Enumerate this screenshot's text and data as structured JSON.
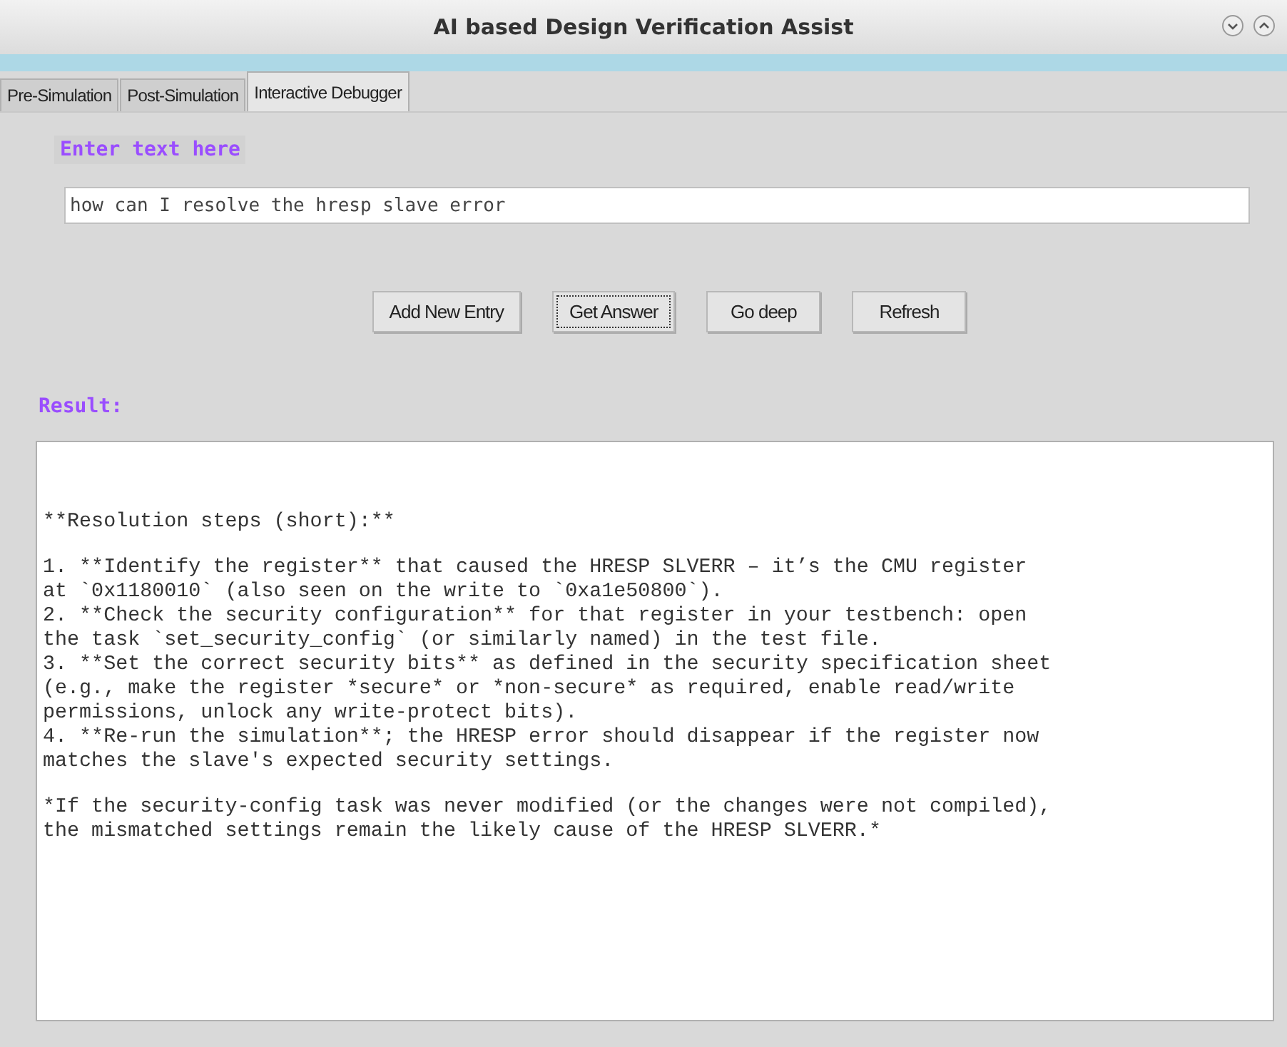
{
  "window": {
    "title": "AI based Design Verification Assist"
  },
  "title_buttons": [
    {
      "kind": "minimize"
    },
    {
      "kind": "maximize"
    }
  ],
  "tabs": [
    {
      "label": "Pre-Simulation",
      "selected": false
    },
    {
      "label": "Post-Simulation",
      "selected": false
    },
    {
      "label": "Interactive Debugger",
      "selected": true
    }
  ],
  "query": {
    "label": "Enter text here",
    "value": "how can I resolve the hresp slave error"
  },
  "buttons": [
    {
      "label": "Add New Entry",
      "focused": false
    },
    {
      "label": "Get Answer",
      "focused": true
    },
    {
      "label": "Go deep",
      "focused": false
    },
    {
      "label": "Refresh",
      "focused": false
    }
  ],
  "result": {
    "label": "Result:",
    "paragraphs": [
      [
        "**Resolution steps (short):**"
      ],
      [
        "1. **Identify the register** that caused the HRESP SLVERR – it’s the CMU register",
        "at `0x1180010` (also seen on the write to `0xa1e50800`).",
        "2. **Check the security configuration** for that register in your testbench: open",
        "the task `set_security_config` (or similarly named) in the test file.",
        "3. **Set the correct security bits** as defined in the security specification sheet",
        "(e.g., make the register *secure* or *non-secure* as required, enable read/write",
        "permissions, unlock any write-protect bits).",
        "4. **Re-run the simulation**; the HRESP error should disappear if the register now",
        "matches the slave's expected security settings."
      ],
      [
        "*If the security-config task was never modified (or the changes were not compiled),",
        "the mismatched settings remain the likely cause of the HRESP SLVERR.*"
      ]
    ]
  }
}
